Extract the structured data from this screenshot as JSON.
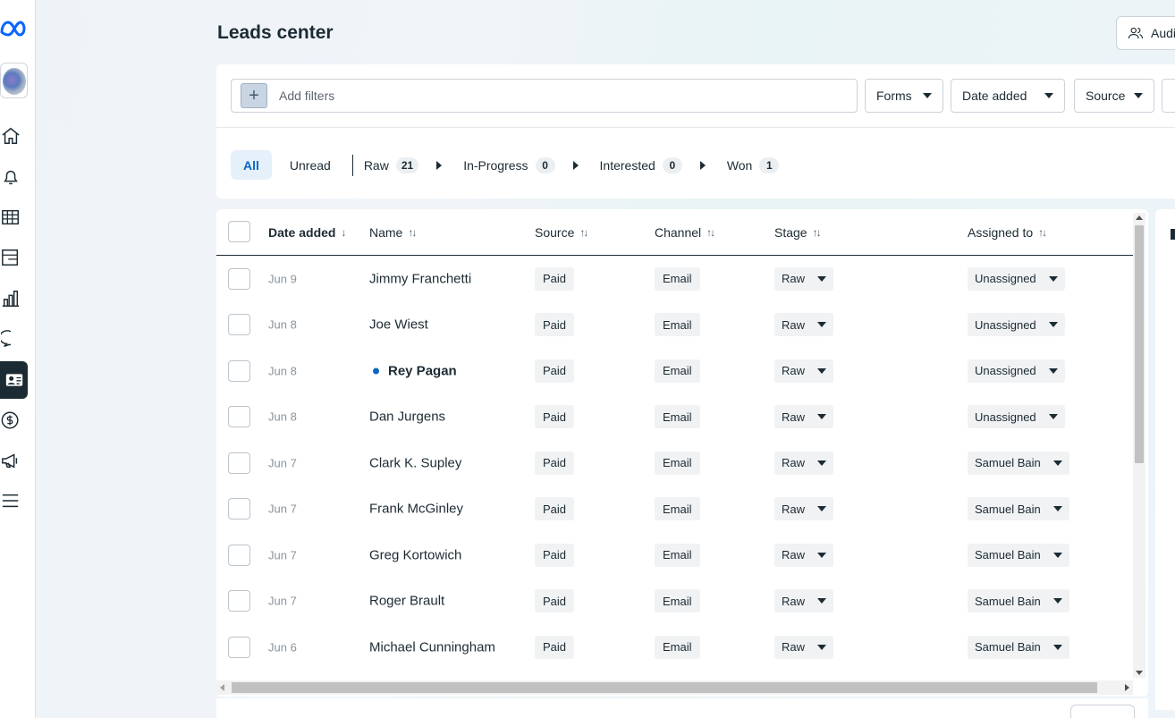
{
  "page": {
    "title": "Leads center",
    "audience_button": "Audi"
  },
  "sidebar": {
    "items": [
      {
        "icon": "meta-logo-icon"
      },
      {
        "icon": "account-avatar"
      },
      {
        "icon": "home-icon"
      },
      {
        "icon": "notifications-bell-icon"
      },
      {
        "icon": "table-grid-icon"
      },
      {
        "icon": "pages-icon"
      },
      {
        "icon": "insights-bar-chart-icon"
      },
      {
        "icon": "messages-chat-icon"
      },
      {
        "icon": "leads-contact-card-icon",
        "active": true
      },
      {
        "icon": "billing-dollar-icon"
      },
      {
        "icon": "ads-megaphone-icon"
      },
      {
        "icon": "menu-hamburger-icon"
      }
    ]
  },
  "filters": {
    "placeholder": "Add filters",
    "dropdowns": [
      "Forms",
      "Date added",
      "Source"
    ]
  },
  "tabs": {
    "all": "All",
    "unread": "Unread",
    "stages": [
      {
        "label": "Raw",
        "count": "21"
      },
      {
        "label": "In-Progress",
        "count": "0"
      },
      {
        "label": "Interested",
        "count": "0"
      },
      {
        "label": "Won",
        "count": "1"
      }
    ]
  },
  "table": {
    "columns": [
      "Date added",
      "Name",
      "Source",
      "Channel",
      "Stage",
      "Assigned to"
    ],
    "rows": [
      {
        "date": "Jun 9",
        "name": "Jimmy Franchetti",
        "source": "Paid",
        "channel": "Email",
        "stage": "Raw",
        "assigned": "Unassigned",
        "unread": false
      },
      {
        "date": "Jun 8",
        "name": "Joe Wiest",
        "source": "Paid",
        "channel": "Email",
        "stage": "Raw",
        "assigned": "Unassigned",
        "unread": false
      },
      {
        "date": "Jun 8",
        "name": "Rey Pagan",
        "source": "Paid",
        "channel": "Email",
        "stage": "Raw",
        "assigned": "Unassigned",
        "unread": true
      },
      {
        "date": "Jun 8",
        "name": "Dan Jurgens",
        "source": "Paid",
        "channel": "Email",
        "stage": "Raw",
        "assigned": "Unassigned",
        "unread": false
      },
      {
        "date": "Jun 7",
        "name": "Clark K. Supley",
        "source": "Paid",
        "channel": "Email",
        "stage": "Raw",
        "assigned": "Samuel Bain",
        "unread": false
      },
      {
        "date": "Jun 7",
        "name": "Frank McGinley",
        "source": "Paid",
        "channel": "Email",
        "stage": "Raw",
        "assigned": "Samuel Bain",
        "unread": false
      },
      {
        "date": "Jun 7",
        "name": "Greg Kortowich",
        "source": "Paid",
        "channel": "Email",
        "stage": "Raw",
        "assigned": "Samuel Bain",
        "unread": false
      },
      {
        "date": "Jun 7",
        "name": "Roger Brault",
        "source": "Paid",
        "channel": "Email",
        "stage": "Raw",
        "assigned": "Samuel Bain",
        "unread": false
      },
      {
        "date": "Jun 6",
        "name": "Michael Cunningham",
        "source": "Paid",
        "channel": "Email",
        "stage": "Raw",
        "assigned": "Samuel Bain",
        "unread": false
      }
    ]
  },
  "colors": {
    "accent": "#0a66c2",
    "text": "#1c2b33",
    "chip_bg": "#f0f2f4"
  }
}
